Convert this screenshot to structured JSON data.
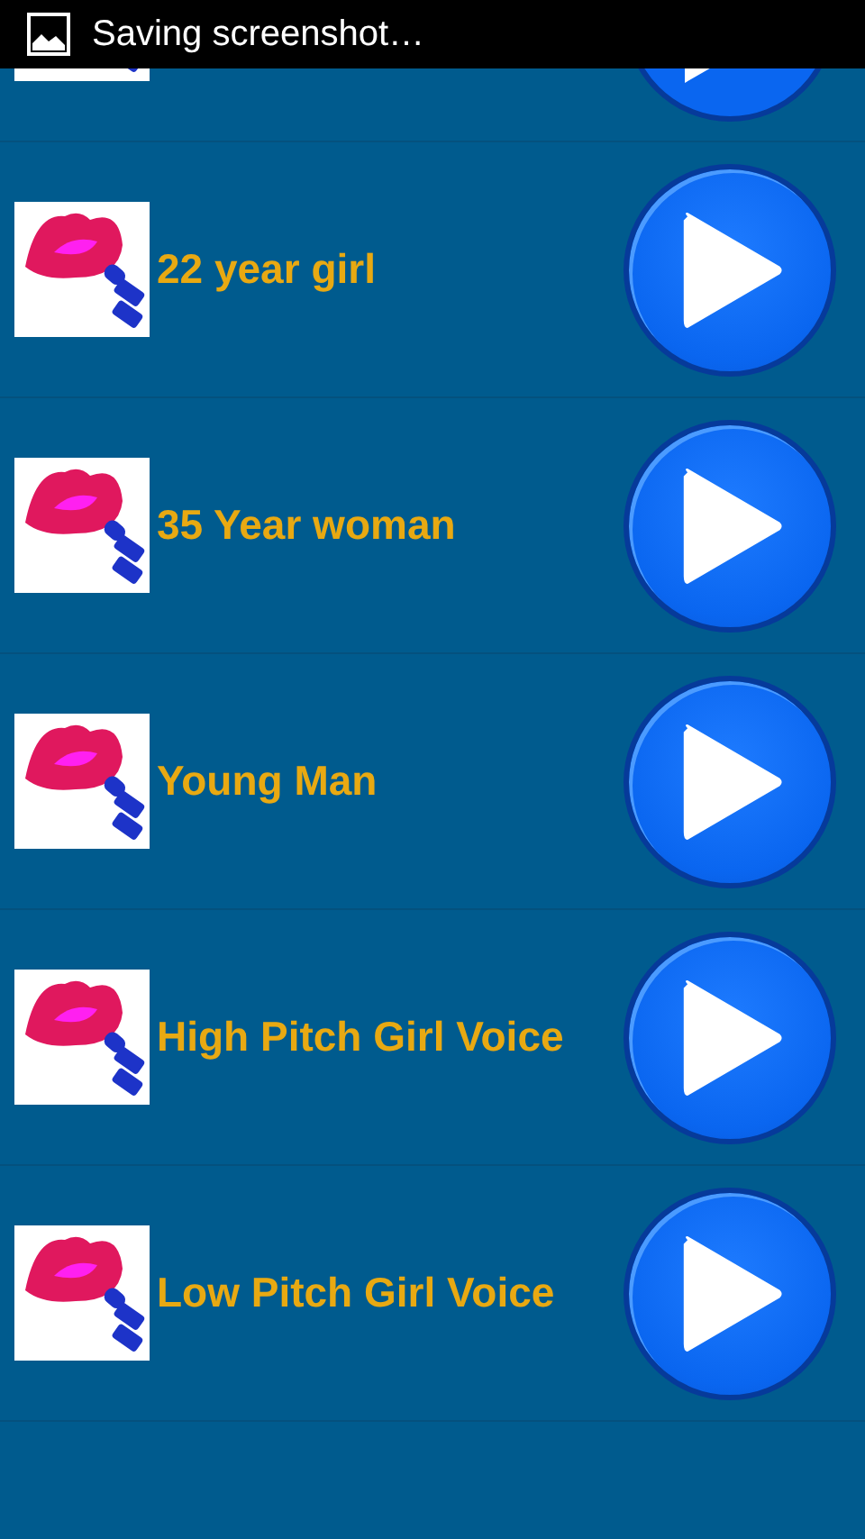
{
  "status_bar": {
    "notification": "Saving screenshot…"
  },
  "rows": [
    {
      "kind": "partial"
    },
    {
      "kind": "full",
      "label": "22 year girl"
    },
    {
      "kind": "full",
      "label": "35 Year woman"
    },
    {
      "kind": "full",
      "label": "Young Man"
    },
    {
      "kind": "full",
      "label": "High Pitch Girl Voice"
    },
    {
      "kind": "full",
      "label": "Low Pitch Girl Voice"
    }
  ]
}
